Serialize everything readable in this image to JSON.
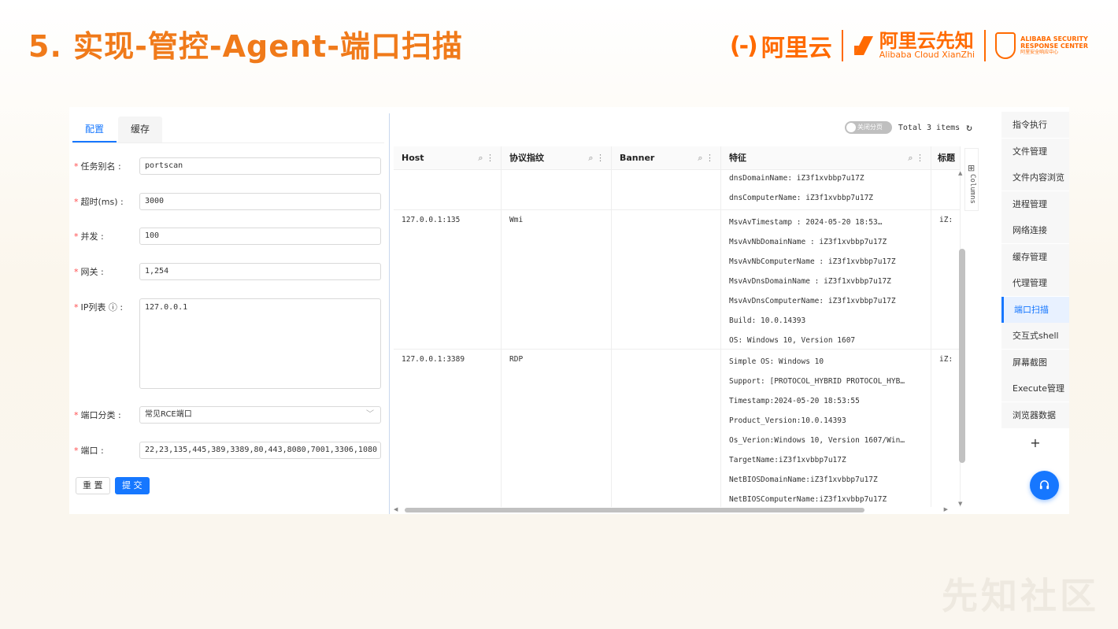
{
  "slide": {
    "title": "5. 实现-管控-Agent-端口扫描"
  },
  "logos": {
    "aliyun_mark": "(-)",
    "aliyun": "阿里云",
    "xianzhi_cn": "阿里云先知",
    "xianzhi_en": "Alibaba Cloud XianZhi",
    "asrc_en_1": "ALIBABA SECURITY",
    "asrc_en_2": "RESPONSE CENTER",
    "asrc_cn": "阿里安全响应中心"
  },
  "watermark": "先知社区",
  "tabs": [
    {
      "label": "配置"
    },
    {
      "label": "缓存"
    }
  ],
  "form": {
    "alias": {
      "label": "任务别名 :",
      "value": "portscan"
    },
    "timeout": {
      "label": "超时(ms) :",
      "value": "3000"
    },
    "concurrency": {
      "label": "并发 :",
      "value": "100"
    },
    "gateway": {
      "label": "网关 :",
      "value": "1,254"
    },
    "ip_list": {
      "label": "IP列表 ⓘ :",
      "value": "127.0.0.1"
    },
    "port_category": {
      "label": "端口分类 :",
      "value": "常见RCE端口"
    },
    "ports": {
      "label": "端口 :",
      "value": "22,23,135,445,389,3389,80,443,8080,7001,3306,1080"
    },
    "reset_label": "重 置",
    "submit_label": "提 交"
  },
  "table": {
    "pagination_toggle": "关闭分页",
    "total": "Total 3 items",
    "columns_label": "Columns",
    "headers": [
      "Host",
      "协议指纹",
      "Banner",
      "特征",
      "标题"
    ],
    "rows": [
      {
        "host": "",
        "protocol": "",
        "banner": "",
        "features": [
          "dnsDomainName: iZ3f1xvbbp7u17Z",
          "dnsComputerName: iZ3f1xvbbp7u17Z"
        ],
        "title": ""
      },
      {
        "host": "127.0.0.1:135",
        "protocol": "Wmi",
        "banner": "",
        "features": [
          "MsvAvTimestamp      : 2024-05-20 18:53…",
          "MsvAvNbDomainName   : iZ3f1xvbbp7u17Z",
          "MsvAvNbComputerName : iZ3f1xvbbp7u17Z",
          "MsvAvDnsDomainName  : iZ3f1xvbbp7u17Z",
          "MsvAvDnsComputerName: iZ3f1xvbbp7u17Z",
          "Build: 10.0.14393",
          "OS: Windows 10, Version 1607"
        ],
        "title": "iZ:"
      },
      {
        "host": "127.0.0.1:3389",
        "protocol": "RDP",
        "banner": "",
        "features": [
          "Simple OS: Windows 10",
          "Support: [PROTOCOL_HYBRID PROTOCOL_HYB…",
          "Timestamp:2024-05-20 18:53:55",
          "Product_Version:10.0.14393",
          "Os_Verion:Windows 10, Version 1607/Win…",
          "TargetName:iZ3f1xvbbp7u17Z",
          "NetBIOSDomainName:iZ3f1xvbbp7u17Z",
          "NetBIOSComputerName:iZ3f1xvbbp7u17Z"
        ],
        "title": "iZ:"
      }
    ]
  },
  "menu": [
    {
      "label": "指令执行"
    },
    {
      "label": "文件管理"
    },
    {
      "label": "文件内容浏览"
    },
    {
      "label": "进程管理"
    },
    {
      "label": "网络连接"
    },
    {
      "label": "缓存管理"
    },
    {
      "label": "代理管理"
    },
    {
      "label": "端口扫描",
      "active": true
    },
    {
      "label": "交互式shell"
    },
    {
      "label": "屏幕截图"
    },
    {
      "label": "Execute管理"
    },
    {
      "label": "浏览器数据"
    }
  ],
  "menu_add": "+",
  "help_icon": "headset-icon"
}
